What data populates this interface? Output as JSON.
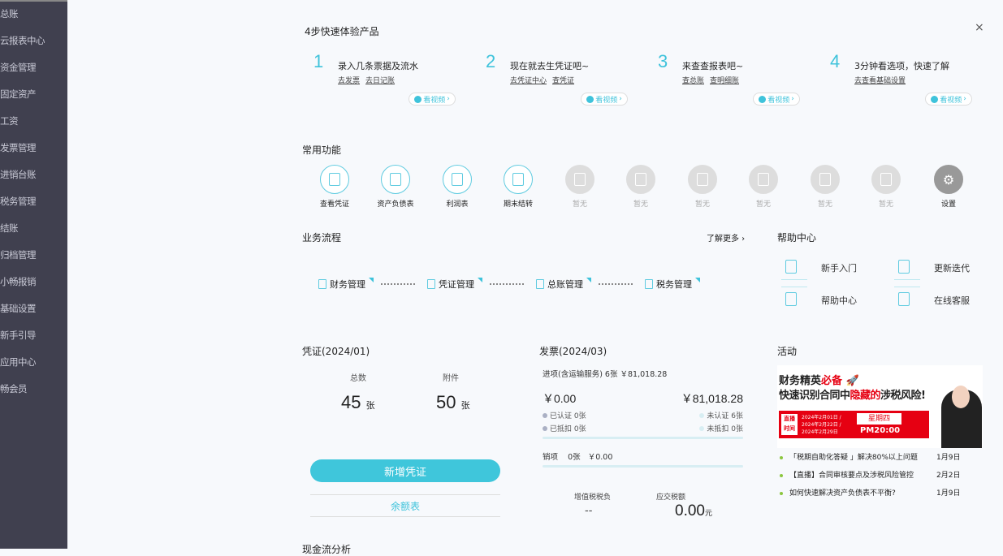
{
  "sidebar": {
    "items": [
      "总账",
      "云报表中心",
      "资金管理",
      "固定资产",
      "工资",
      "发票管理",
      "进销台账",
      "税务管理",
      "结账",
      "归档管理",
      "小畅报销",
      "基础设置",
      "新手引导",
      "应用中心",
      "畅会员"
    ]
  },
  "quickstart": {
    "title": "4步快速体验产品",
    "close": "×",
    "video_label": "看视频",
    "steps": [
      {
        "num": "1",
        "title": "录入几条票据及流水",
        "links": [
          "去发票",
          "去日记账"
        ]
      },
      {
        "num": "2",
        "title": "现在就去生凭证吧~",
        "links": [
          "去凭证中心",
          "查凭证"
        ]
      },
      {
        "num": "3",
        "title": "来查查报表吧~",
        "links": [
          "查总账",
          "查明细账"
        ]
      },
      {
        "num": "4",
        "title": "3分钟看选项，快速了解",
        "links": [
          "去查看基础设置"
        ]
      }
    ]
  },
  "functions": {
    "title": "常用功能",
    "items": [
      "查看凭证",
      "资产负债表",
      "利润表",
      "期末结转",
      "暂无",
      "暂无",
      "暂无",
      "暂无",
      "暂无",
      "暂无",
      "设置"
    ]
  },
  "flow": {
    "title": "业务流程",
    "more": "了解更多 ›",
    "steps": [
      "财务管理",
      "凭证管理",
      "总账管理",
      "税务管理"
    ]
  },
  "help": {
    "title": "帮助中心",
    "items": [
      "新手入门",
      "更新迭代",
      "帮助中心",
      "在线客服"
    ]
  },
  "voucher": {
    "title": "凭证(2024/01)",
    "total_label": "总数",
    "total": "45",
    "attach_label": "附件",
    "attach": "50",
    "unit": "张",
    "new_button": "新增凭证",
    "balance_button": "余额表"
  },
  "invoice": {
    "title": "发票(2024/03)",
    "input_line": "进项(含运输服务)  6张  ￥81,018.28",
    "left_amount": "￥0.00",
    "right_amount": "￥81,018.28",
    "certified": "已认证  0张",
    "deducted": "已抵扣  0张",
    "uncertified": "未认证  6张",
    "undeducted": "未抵扣  0张",
    "output_label": "销项",
    "output_count": "0张",
    "output_amount": "￥0.00",
    "vat_label": "增值税税负",
    "vat_value": "--",
    "tax_label": "应交税额",
    "tax_value": "0.00",
    "tax_unit": "元"
  },
  "activity": {
    "title": "活动",
    "banner_line1a": "财务精英",
    "banner_line1b": "必备",
    "banner_line2a": "快速识别合同中",
    "banner_line2b": "隐藏的",
    "banner_line2c": "涉税风险!",
    "banner_time_label": "直播时间",
    "banner_dates": "2024年2月01日 / 2024年2月22日 / 2024年2月29日",
    "banner_day": "星期四",
    "banner_pm": "PM20:00",
    "news": [
      {
        "text": "「税期自助化答疑 」解决80%以上问题",
        "date": "1月9日"
      },
      {
        "text": "【直播】合同审核要点及涉税风险管控",
        "date": "2月2日"
      },
      {
        "text": "如何快速解决资产负债表不平衡?",
        "date": "1月9日"
      }
    ]
  },
  "cashflow": {
    "title": "现金流分析"
  }
}
